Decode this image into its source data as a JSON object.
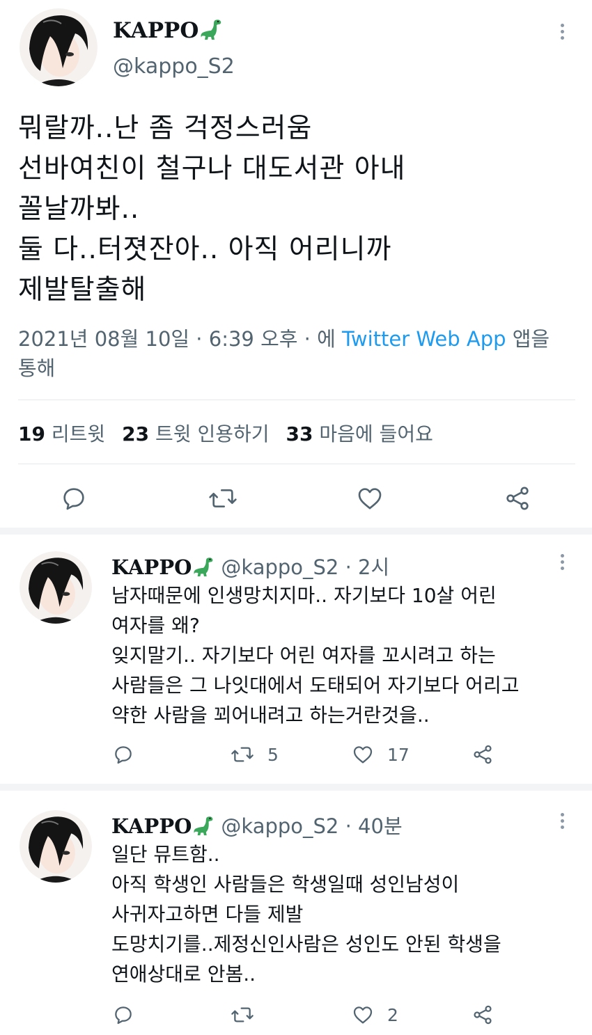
{
  "main_tweet": {
    "display_name": "KAPPO",
    "handle": "@kappo_S2",
    "lines": [
      "뭐랄까..난 좀 걱정스러움",
      "선바여친이 철구나 대도서관 아내",
      "꼴날까봐..",
      "둘 다..터졋잔아.. 아직 어리니까",
      "제발탈출해"
    ],
    "meta_date": "2021년 08월 10일 · 6:39 오후 · 에 ",
    "meta_app": "Twitter Web App",
    "meta_suffix": " 앱을",
    "meta_line2": "통해",
    "stats": {
      "retweets_num": "19",
      "retweets_label": "리트윗",
      "quotes_num": "23",
      "quotes_label": "트윗 인용하기",
      "likes_num": "33",
      "likes_label": "마음에 들어요"
    }
  },
  "replies": [
    {
      "display_name": "KAPPO",
      "handle": "@kappo_S2",
      "time": "· 2시",
      "lines": [
        "남자때문에 인생망치지마.. 자기보다 10살 어린",
        "여자를 왜?",
        "잊지말기.. 자기보다 어린 여자를 꼬시려고 하는",
        "사람들은 그 나잇대에서 도태되어 자기보다 어리고",
        "약한 사람을 꾀어내려고 하는거란것을.."
      ],
      "retweet_count": "5",
      "like_count": "17"
    },
    {
      "display_name": "KAPPO",
      "handle": "@kappo_S2",
      "time": "· 40분",
      "lines": [
        "일단 뮤트함..",
        "아직 학생인 사람들은 학생일때 성인남성이",
        "사귀자고하면 다들 제발",
        "도망치기를..제정신인사람은 성인도 안된 학생을",
        "연애상대로 안봄.."
      ],
      "retweet_count": "",
      "like_count": "2"
    }
  ],
  "colors": {
    "text": "#0f1419",
    "muted": "#536471",
    "link": "#1d9bf0",
    "dino": "#3aa75a"
  }
}
